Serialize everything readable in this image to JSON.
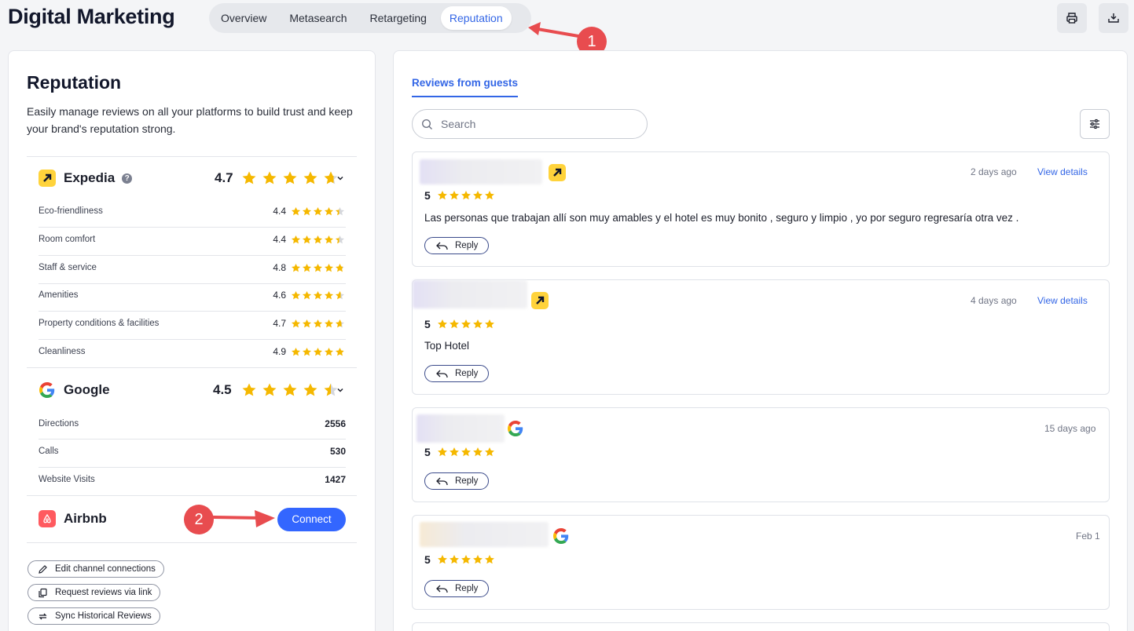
{
  "header": {
    "title": "Digital Marketing",
    "tabs": [
      {
        "label": "Overview",
        "active": false
      },
      {
        "label": "Metasearch",
        "active": false
      },
      {
        "label": "Retargeting",
        "active": false
      },
      {
        "label": "Reputation",
        "active": true
      }
    ],
    "print_icon": "printer-icon",
    "export_icon": "download-tray-icon"
  },
  "annotations": {
    "marker_1": "1",
    "marker_2": "2",
    "color": "#e84c4f"
  },
  "left": {
    "title": "Reputation",
    "description": "Easily manage reviews on all your platforms to build trust and keep your brand's reputation strong.",
    "channels": {
      "expedia": {
        "name": "Expedia",
        "help_icon": "?",
        "score": "4.7",
        "rating": 4.7,
        "metrics": [
          {
            "label": "Eco-friendliness",
            "value": "4.4",
            "rating": 4.4
          },
          {
            "label": "Room comfort",
            "value": "4.4",
            "rating": 4.4
          },
          {
            "label": "Staff & service",
            "value": "4.8",
            "rating": 4.8
          },
          {
            "label": "Amenities",
            "value": "4.6",
            "rating": 4.6
          },
          {
            "label": "Property conditions & facilities",
            "value": "4.7",
            "rating": 4.7
          },
          {
            "label": "Cleanliness",
            "value": "4.9",
            "rating": 4.9
          }
        ]
      },
      "google": {
        "name": "Google",
        "score": "4.5",
        "rating": 4.5,
        "metrics": [
          {
            "label": "Directions",
            "value": "2556"
          },
          {
            "label": "Calls",
            "value": "530"
          },
          {
            "label": "Website Visits",
            "value": "1427"
          }
        ]
      },
      "airbnb": {
        "name": "Airbnb",
        "connect_label": "Connect"
      }
    },
    "actions": [
      {
        "label": "Edit channel connections",
        "icon": "pencil-icon"
      },
      {
        "label": "Request reviews via link",
        "icon": "copy-icon"
      },
      {
        "label": "Sync Historical Reviews",
        "icon": "sync-icon"
      }
    ]
  },
  "right": {
    "tab_label": "Reviews from guests",
    "search_placeholder": "Search",
    "reviews": [
      {
        "source": "expedia",
        "date": "2 days ago",
        "view_details": "View details",
        "rating": "5",
        "text": "Las personas que trabajan allí son muy amables y el hotel es muy bonito , seguro y limpio , yo por seguro regresaría otra vez .",
        "reply_label": "Reply"
      },
      {
        "source": "expedia",
        "date": "4 days ago",
        "view_details": "View details",
        "rating": "5",
        "text": "Top Hotel",
        "reply_label": "Reply"
      },
      {
        "source": "google",
        "date": "15 days ago",
        "rating": "5",
        "text": "",
        "reply_label": "Reply"
      },
      {
        "source": "google",
        "date": "Feb 1",
        "rating": "5",
        "text": "",
        "reply_label": "Reply"
      }
    ]
  },
  "colors": {
    "accent": "#3366e6",
    "connect": "#3366ff",
    "star": "#f5b800",
    "expedia_yellow": "#ffd33b",
    "airbnb": "#ff5a5f"
  }
}
